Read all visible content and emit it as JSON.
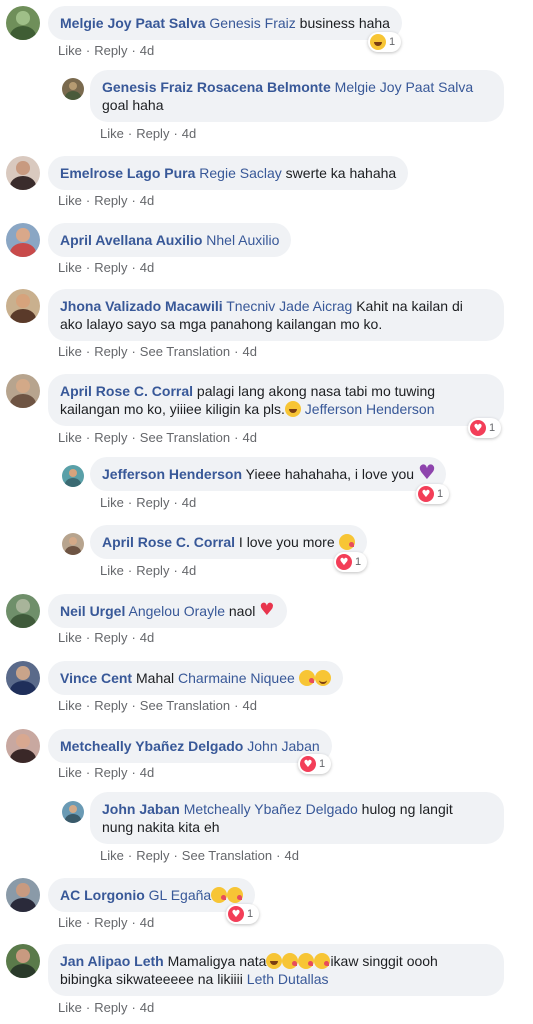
{
  "labels": {
    "like": "Like",
    "reply": "Reply",
    "see_translation": "See Translation",
    "sep": "·"
  },
  "comments": [
    {
      "author": "Melgie Joy Paat Salva",
      "mention": "Genesis Fraiz",
      "text": " business haha",
      "time": "4d",
      "react": "haha",
      "react_count": "1"
    },
    {
      "author": "Genesis Fraiz Rosacena Belmonte",
      "mention": "Melgie Joy Paat Salva",
      "text": "goal haha",
      "time": "4d"
    },
    {
      "author": "Emelrose Lago Pura",
      "mention": "Regie Saclay",
      "text": " swerte ka hahaha",
      "time": "4d"
    },
    {
      "author": "April Avellana Auxilio",
      "mention": "Nhel Auxilio",
      "text": "",
      "time": "4d"
    },
    {
      "author": "Jhona Valizado Macawili",
      "mention": "Tnecniv Jade Aicrag",
      "text1": " Kahit na kailan di",
      "text2": "ako lalayo sayo sa mga panahong kailangan mo ko.",
      "time": "4d"
    },
    {
      "author": "April Rose C. Corral",
      "text1": " palagi lang akong nasa tabi mo tuwing",
      "text2": "kailangan mo ko, yiiiee kiligin ka pls.",
      "mention": "Jefferson Henderson",
      "time": "4d",
      "react": "love",
      "react_count": "1"
    },
    {
      "author": "Jefferson Henderson",
      "text": " Yieee hahahaha, i love you ",
      "time": "4d",
      "react": "love",
      "react_count": "1"
    },
    {
      "author": "April Rose C. Corral",
      "text": " I love you more ",
      "time": "4d",
      "react": "love",
      "react_count": "1"
    },
    {
      "author": "Neil Urgel",
      "mention": "Angelou Orayle",
      "text": " naol ",
      "time": "4d"
    },
    {
      "author": "Vince Cent",
      "text": " Mahal ",
      "mention": "Charmaine Niquee",
      "time": "4d"
    },
    {
      "author": "Metcheally Ybañez Delgado",
      "mention": "John Jaban",
      "time": "4d",
      "react": "love",
      "react_count": "1"
    },
    {
      "author": "John Jaban",
      "mention": "Metcheally Ybañez Delgado",
      "text1": " hulog ng langit",
      "text2": "nung nakita kita eh",
      "time": "4d"
    },
    {
      "author": "AC Lorgonio",
      "mention": "GL Egaña",
      "time": "4d",
      "react": "love",
      "react_count": "1"
    },
    {
      "author": "Jan Alipao Leth",
      "text1": " Mamaligya nata",
      "text1b": "ikaw singgit oooh",
      "text2": "bibingka sikwateeeee na likiiii ",
      "mention": "Leth Dutallas",
      "time": "4d"
    }
  ],
  "colors": {
    "link": "#385898",
    "bubble": "#f0f2f5",
    "meta": "#65676b",
    "love": "#f33e58",
    "haha": "#f7c535"
  }
}
